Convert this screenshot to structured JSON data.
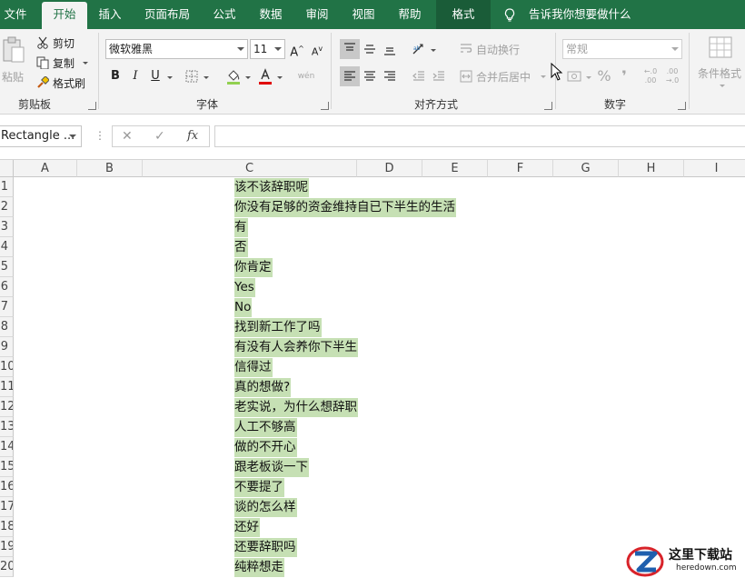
{
  "tabs": [
    "文件",
    "开始",
    "插入",
    "页面布局",
    "公式",
    "数据",
    "审阅",
    "视图",
    "帮助",
    "格式"
  ],
  "tell_me": "告诉我你想要做什么",
  "clipboard": {
    "paste": "粘贴",
    "cut": "剪切",
    "copy": "复制",
    "format_painter": "格式刷",
    "group": "剪贴板"
  },
  "font": {
    "name": "微软雅黑",
    "size": "11",
    "grow": "A",
    "shrink": "A",
    "bold": "B",
    "italic": "I",
    "underline": "U",
    "wen": "wén",
    "group": "字体"
  },
  "alignment": {
    "wrap": "自动换行",
    "merge": "合并后居中",
    "group": "对齐方式"
  },
  "number": {
    "format": "常规",
    "percent": "%",
    "comma": "❜",
    "group": "数字"
  },
  "styles": {
    "conditional": "条件格式"
  },
  "formula_bar": {
    "name_box": "Rectangle ...",
    "fx": "fx",
    "cancel": "✕",
    "confirm": "✓",
    "value": ""
  },
  "columns": [
    "A",
    "B",
    "C",
    "D",
    "E",
    "F",
    "G",
    "H",
    "I"
  ],
  "rows": [
    "1",
    "2",
    "3",
    "4",
    "5",
    "6",
    "7",
    "8",
    "9",
    "10",
    "11",
    "12",
    "13",
    "14",
    "15",
    "16",
    "17",
    "18",
    "19",
    "20"
  ],
  "cells": [
    "该不该辞职呢",
    "你没有足够的资金维持自已下半生的生活",
    "有",
    "否",
    "你肯定",
    "Yes",
    "No",
    "找到新工作了吗",
    "有没有人会养你下半生",
    "信得过",
    "真的想做?",
    "老实说，为什么想辞职",
    "人工不够高",
    "做的不开心",
    "跟老板谈一下",
    "不要提了",
    "谈的怎么样",
    "还好",
    "还要辞职吗",
    "纯粹想走"
  ],
  "watermark": {
    "title": "这里下载站",
    "url": "heredown.com"
  },
  "colors": {
    "brand": "#217346",
    "highlight": "#c6e0b4"
  }
}
